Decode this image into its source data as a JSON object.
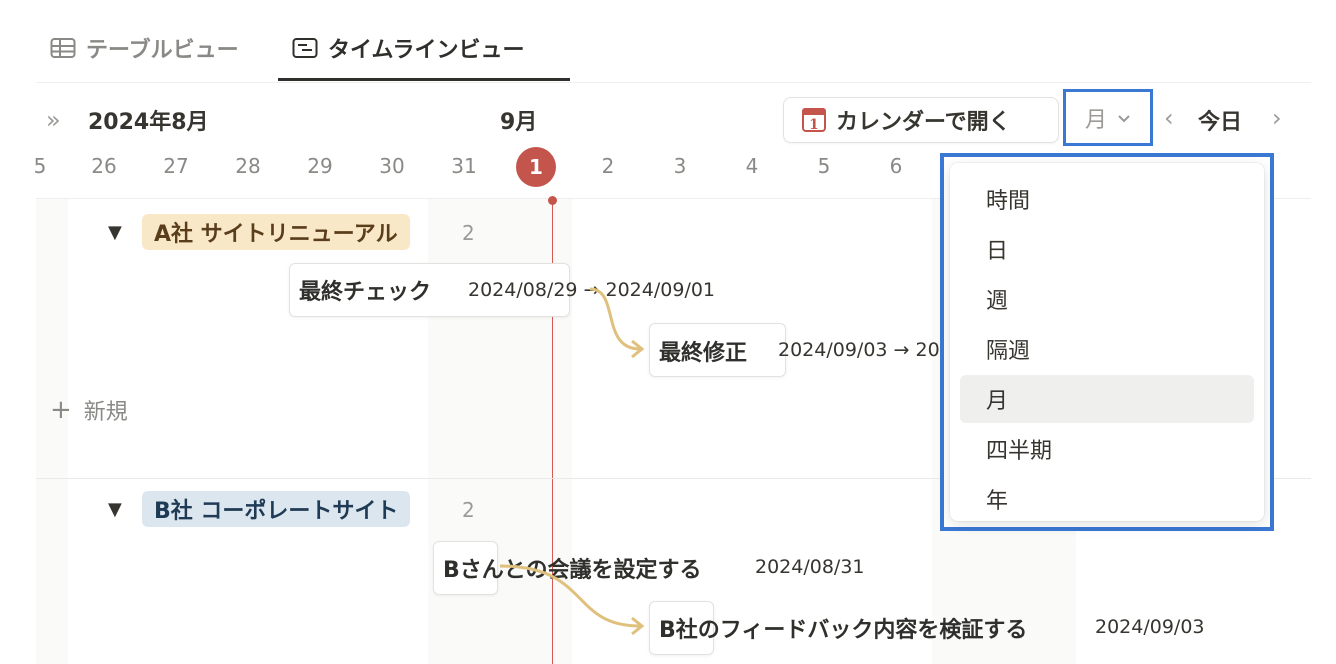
{
  "tabs": [
    {
      "label": "テーブルビュー",
      "icon": "table-icon"
    },
    {
      "label": "タイムラインビュー",
      "icon": "timeline-icon"
    }
  ],
  "header": {
    "expand_icon": "»",
    "month_left": "2024年8月",
    "month_mid": "9月",
    "open_calendar_label": "カレンダーで開く",
    "calendar_icon_day": "1",
    "period_value": "月",
    "prev_icon": "‹",
    "today_label": "今日",
    "next_icon": "›"
  },
  "days": [
    "5",
    "26",
    "27",
    "28",
    "29",
    "30",
    "31",
    "1",
    "2",
    "3",
    "4",
    "5",
    "6"
  ],
  "today_day": "1",
  "groups": [
    {
      "triangle": "▼",
      "name": "A社 サイトリニューアル",
      "count": "2",
      "items": [
        {
          "title": "最終チェック",
          "dates": "2024/08/29 → 2024/09/01"
        },
        {
          "title": "最終修正",
          "dates": "2024/09/03 → 20"
        }
      ],
      "new_icon": "+",
      "new_label": "新規"
    },
    {
      "triangle": "▼",
      "name": "B社 コーポレートサイト",
      "count": "2",
      "items": [
        {
          "title": "Bさんとの会議を設定する",
          "dates": "2024/08/31"
        },
        {
          "title": "B社のフィードバック内容を検証する",
          "dates": "2024/09/03"
        }
      ]
    }
  ],
  "period_options": [
    "時間",
    "日",
    "週",
    "隔週",
    "月",
    "四半期",
    "年"
  ],
  "selected_period": "月",
  "colors": {
    "accent_highlight": "#3a78d4",
    "today": "#c4554d",
    "dependency_arrow": "#e0c07d",
    "group_a_tag": "#f8e8c7",
    "group_b_tag": "#dbe6ef"
  }
}
